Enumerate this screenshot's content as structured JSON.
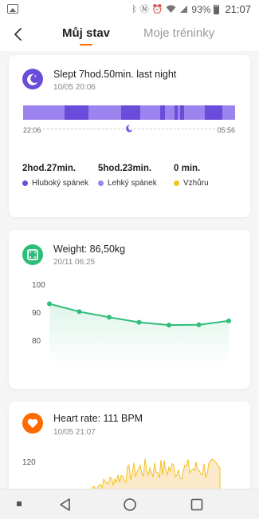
{
  "status_bar": {
    "battery_percent": "93%",
    "time": "21:07",
    "icons": [
      "image-icon",
      "bluetooth-icon",
      "nfc-icon",
      "alarm-icon",
      "wifi-icon",
      "signal-icon",
      "battery-icon"
    ]
  },
  "header": {
    "back_icon": "back-arrow-icon",
    "tabs": [
      {
        "label": "Můj stav",
        "active": true
      },
      {
        "label": "Moje tréninky",
        "active": false
      }
    ],
    "accent_color": "#ff6a00"
  },
  "sleep": {
    "icon": "moon-icon",
    "title": "Slept 7hod.50min. last night",
    "date": "10/05 20:06",
    "start_time": "22:06",
    "end_time": "05:56",
    "colors": {
      "deep": "#6a4cdb",
      "light": "#9b84ee",
      "awake": "#f4c21f"
    },
    "stats": [
      {
        "value": "2hod.27min.",
        "label": "Hluboký spánek",
        "color": "#6a4cdb"
      },
      {
        "value": "5hod.23min.",
        "label": "Lehký spánek",
        "color": "#9b84ee"
      },
      {
        "value": "0 min.",
        "label": "Vzhůru",
        "color": "#f4c21f"
      }
    ]
  },
  "weight": {
    "icon": "scale-icon",
    "title": "Weight: 86,50kg",
    "date": "20/11 06:25",
    "color": "#2fbd7a",
    "chart_data": {
      "type": "line",
      "title": "",
      "xlabel": "",
      "ylabel": "",
      "ylim": [
        80,
        100
      ],
      "yticks": [
        "100",
        "90",
        "80"
      ],
      "series": [
        {
          "values": [
            93,
            90.2,
            88.2,
            86.4,
            85.4,
            85.5,
            86.9
          ]
        }
      ]
    }
  },
  "heart": {
    "icon": "heart-icon",
    "title": "Heart rate: 111 BPM",
    "date": "10/05 21:07",
    "color": "#f4c21f",
    "chart_data": {
      "type": "area",
      "title": "",
      "xlabel": "",
      "ylabel": "",
      "yticks": [
        "120"
      ]
    }
  },
  "nav_bar": {
    "items": [
      "recent-dot-icon",
      "back-triangle-icon",
      "home-circle-icon",
      "overview-square-icon"
    ]
  }
}
